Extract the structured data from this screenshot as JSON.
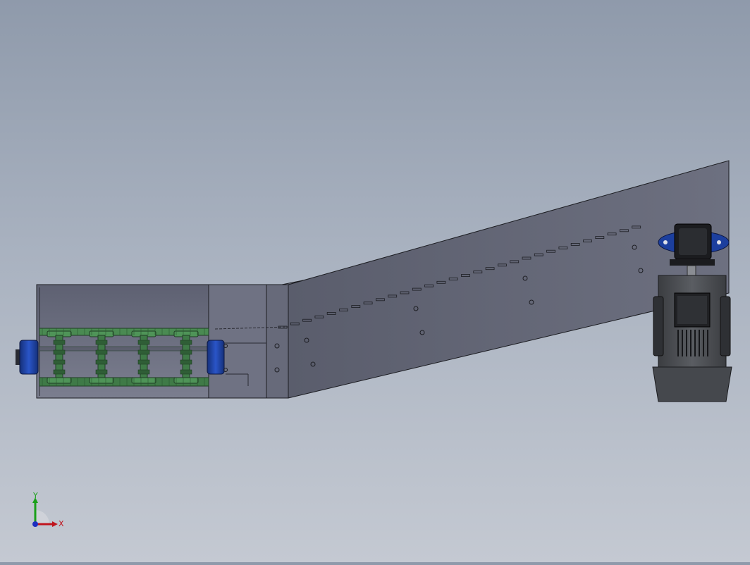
{
  "viewport": {
    "background_top": "#8f9aab",
    "background_bottom": "#c4c9d2"
  },
  "model": {
    "components": [
      "conveyor-frame",
      "inclined-section",
      "chain-belt",
      "drive-sprocket-left",
      "drive-sprocket-right",
      "gear-motor"
    ],
    "colors": {
      "frame": "#6c6f80",
      "chain": "#3f7a47",
      "chain_dark": "#24472a",
      "sprocket": "#1c3f9e",
      "motor": "#4b4e52",
      "motor_dark": "#2a2b2e"
    }
  },
  "triad": {
    "x_label": "X",
    "y_label": "Y",
    "x_color": "#c0141e",
    "y_color": "#1aa01a",
    "z_color": "#1e2fc0"
  }
}
